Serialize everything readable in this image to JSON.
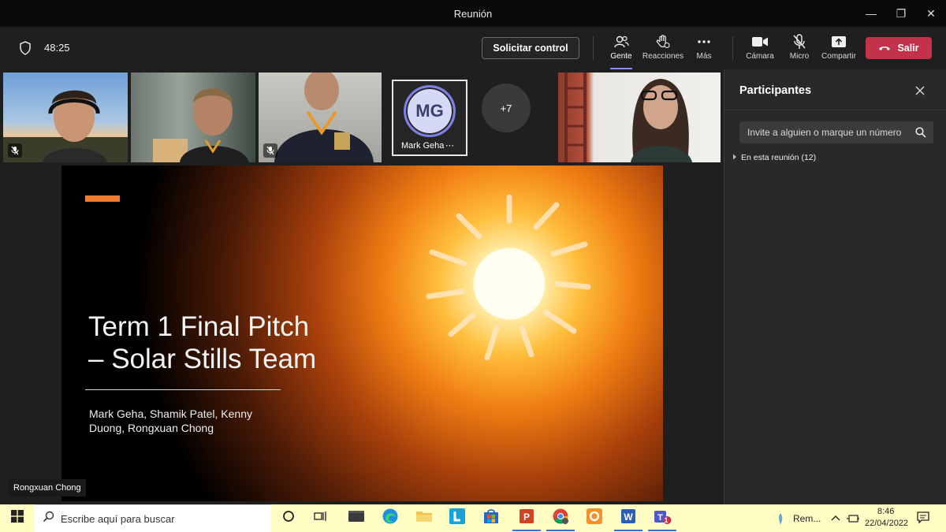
{
  "window": {
    "title": "Reunión"
  },
  "toolbar": {
    "timer": "48:25",
    "request_control": "Solicitar control",
    "people": "Gente",
    "reactions": "Reacciones",
    "more": "Más",
    "camera": "Cámara",
    "mic": "Micro",
    "share": "Compartir",
    "leave": "Salir"
  },
  "participants_strip": {
    "mark_initials": "MG",
    "mark_name": "Mark Geha",
    "more_count": "+7"
  },
  "slide": {
    "title_line1": "Term 1 Final Pitch",
    "title_line2": "– Solar Stills Team",
    "subtitle": "Mark Geha, Shamik Patel, Kenny Duong, Rongxuan Chong",
    "presenter": "Rongxuan Chong"
  },
  "panel": {
    "title": "Participantes",
    "invite_placeholder": "Invite a alguien o marque un número",
    "in_meeting": "En esta reunión (12)"
  },
  "taskbar": {
    "search_placeholder": "Escribe aquí para buscar",
    "tray_label": "Rem...",
    "time": "8:46",
    "date": "22/04/2022",
    "teams_badge": "1"
  },
  "colors": {
    "leave": "#c4314b",
    "accent": "#8b8cf0",
    "slide_bar": "#ee7d31",
    "taskbar": "#fffcc4"
  }
}
